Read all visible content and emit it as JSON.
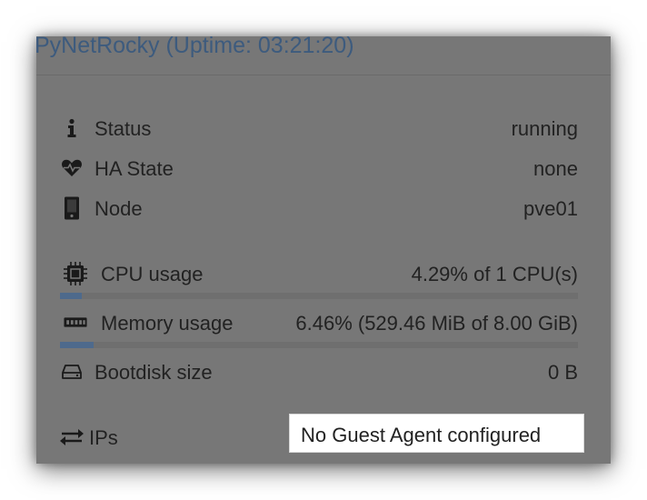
{
  "panel": {
    "title": "PyNetRocky (Uptime: 03:21:20)"
  },
  "rows": {
    "status": {
      "icon": "info-icon",
      "label": "Status",
      "value": "running"
    },
    "ha_state": {
      "icon": "heartbeat-icon",
      "label": "HA State",
      "value": "none"
    },
    "node": {
      "icon": "server-icon",
      "label": "Node",
      "value": "pve01"
    },
    "cpu": {
      "icon": "cpu-chip-icon",
      "label": "CPU usage",
      "value": "4.29% of 1 CPU(s)",
      "usage_fraction": 0.0429
    },
    "memory": {
      "icon": "memory-module-icon",
      "label": "Memory usage",
      "value": "6.46% (529.46 MiB of 8.00 GiB)",
      "usage_fraction": 0.0646
    },
    "bootdisk": {
      "icon": "hard-drive-icon",
      "label": "Bootdisk size",
      "value": "0 B"
    },
    "ips": {
      "icon": "exchange-arrows-icon",
      "label": "IPs",
      "value": "No Guest Agent configured"
    }
  },
  "colors": {
    "panel_background": "#777777",
    "title_text": "#3d5b7e",
    "usage_bar_fill": "#4e6a8c",
    "usage_bar_track": "#6f6f6f"
  }
}
